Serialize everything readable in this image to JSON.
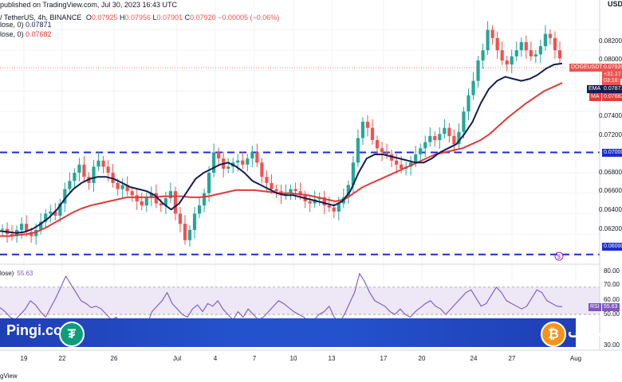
{
  "header": {
    "published": "published on TradingView.com, Jul 30, 2023 16:43 UTC",
    "symbol_line": "/ TetherUS, 4h, BINANCE",
    "ohlc": {
      "o_label": "O",
      "o": "0.07925",
      "h_label": "H",
      "h": "0.07956",
      "l_label": "L",
      "l": "0.07901",
      "c_label": "C",
      "c": "0.07920",
      "change": "−0.00005 (−0.06%)"
    },
    "ema_line_label": "lose, 0)",
    "ema_line_value": "0.07871",
    "ma_line_label": "lose, 0)",
    "ma_line_value": "0.07682",
    "corner_label": "USDT"
  },
  "colors": {
    "up": "#26a69a",
    "down": "#ef5350",
    "ema": "#131e4f",
    "ma": "#e23a3a",
    "level": "#1b2bd6",
    "rsi": "#7e57c2",
    "rsi_band": "#ede7f6",
    "brand": "#2451cc"
  },
  "icons": {
    "tether": "tether-icon",
    "bitcoin": "bitcoin-icon",
    "chart-event": "dollar-event-icon"
  },
  "badges": {
    "symbol": "DOGEUSDT",
    "last_price": "0.07920",
    "change_line": "+31.17",
    "countdown": "03:16:",
    "ema_name": "EMA",
    "ema_value": "0.07871",
    "ma_name": "MA",
    "ma_value": "0.07682",
    "rsi_name": "RSI",
    "rsi_value": "55.63",
    "level_high": "0.07000",
    "level_low": "0.06000"
  },
  "price_axis": {
    "ticks": [
      "0.08200",
      "0.08000",
      "0.07400",
      "0.07200",
      "0.06800",
      "0.06600",
      "0.06400",
      "0.06200"
    ]
  },
  "rsi_axis": {
    "ticks": [
      "80.00",
      "70.00",
      "60.00",
      "50.00",
      "30.00"
    ]
  },
  "rsi_panel": {
    "title": "lose)",
    "value": "55.63"
  },
  "time_axis": {
    "labels": [
      "19",
      "22",
      "26",
      "Jul",
      "4",
      "7",
      "10",
      "13",
      "17",
      "20",
      "24",
      "27",
      "Aug"
    ]
  },
  "brand": {
    "left": "Pingi.co",
    "right": "پینگی"
  },
  "footer": "gView",
  "chart_data": {
    "type": "candlestick",
    "title": "DOGE / TetherUS, 4h, BINANCE",
    "timeframe": "4h",
    "xlabels": [
      "19",
      "22",
      "26",
      "Jul",
      "4",
      "7",
      "10",
      "13",
      "17",
      "20",
      "24",
      "27",
      "Aug"
    ],
    "price_range": [
      0.0592,
      0.0843
    ],
    "horizontal_levels": [
      0.07,
      0.06
    ],
    "close_series": [
      0.0625,
      0.062,
      0.0618,
      0.0624,
      0.063,
      0.0622,
      0.0618,
      0.0624,
      0.0632,
      0.064,
      0.0642,
      0.0638,
      0.065,
      0.0664,
      0.0672,
      0.068,
      0.0688,
      0.0676,
      0.067,
      0.0686,
      0.0692,
      0.0686,
      0.068,
      0.067,
      0.0664,
      0.0668,
      0.0662,
      0.0658,
      0.0652,
      0.0648,
      0.0656,
      0.066,
      0.065,
      0.0648,
      0.0655,
      0.0662,
      0.064,
      0.063,
      0.0614,
      0.0624,
      0.064,
      0.0648,
      0.066,
      0.068,
      0.07,
      0.0694,
      0.0684,
      0.0686,
      0.069,
      0.0692,
      0.0688,
      0.0694,
      0.07,
      0.069,
      0.0676,
      0.067,
      0.0664,
      0.0662,
      0.0658,
      0.066,
      0.0664,
      0.0662,
      0.0658,
      0.0652,
      0.065,
      0.0654,
      0.0656,
      0.0648,
      0.0646,
      0.0642,
      0.065,
      0.0656,
      0.0668,
      0.069,
      0.0714,
      0.073,
      0.0724,
      0.0712,
      0.0704,
      0.07,
      0.0698,
      0.0692,
      0.0688,
      0.0684,
      0.0686,
      0.069,
      0.0698,
      0.0704,
      0.071,
      0.0716,
      0.0712,
      0.0718,
      0.0724,
      0.0716,
      0.0708,
      0.072,
      0.074,
      0.0756,
      0.077,
      0.079,
      0.08,
      0.082,
      0.0812,
      0.08,
      0.079,
      0.0786,
      0.0794,
      0.08,
      0.0808,
      0.08,
      0.0794,
      0.0796,
      0.0804,
      0.0816,
      0.0812,
      0.08,
      0.0792
    ],
    "ema_series": [
      0.0623,
      0.0622,
      0.0621,
      0.0622,
      0.0625,
      0.063,
      0.0636,
      0.0644,
      0.0655,
      0.0664,
      0.067,
      0.0674,
      0.0676,
      0.0676,
      0.0674,
      0.067,
      0.0666,
      0.0664,
      0.0662,
      0.0658,
      0.065,
      0.0644,
      0.065,
      0.0662,
      0.0674,
      0.068,
      0.0684,
      0.0688,
      0.069,
      0.0686,
      0.068,
      0.0672,
      0.0668,
      0.0664,
      0.066,
      0.0658,
      0.0658,
      0.0656,
      0.0654,
      0.0652,
      0.065,
      0.0648,
      0.0652,
      0.0662,
      0.068,
      0.0694,
      0.0698,
      0.0698,
      0.0696,
      0.0694,
      0.0692,
      0.069,
      0.069,
      0.0694,
      0.07,
      0.0704,
      0.0708,
      0.0718,
      0.073,
      0.0748,
      0.0762,
      0.077,
      0.0774,
      0.0772,
      0.077,
      0.0772,
      0.0776,
      0.0782,
      0.0786,
      0.0787
    ],
    "ma_series": [
      0.0618,
      0.0618,
      0.0619,
      0.062,
      0.0622,
      0.0626,
      0.0631,
      0.0636,
      0.0641,
      0.0645,
      0.0648,
      0.065,
      0.0652,
      0.0654,
      0.0656,
      0.0656,
      0.0656,
      0.0656,
      0.0657,
      0.0657,
      0.0657,
      0.0656,
      0.0656,
      0.0657,
      0.0659,
      0.0661,
      0.0663,
      0.0663,
      0.0663,
      0.0662,
      0.0661,
      0.066,
      0.066,
      0.0659,
      0.0658,
      0.0656,
      0.0654,
      0.0652,
      0.0654,
      0.066,
      0.0666,
      0.067,
      0.0674,
      0.0678,
      0.0682,
      0.0686,
      0.069,
      0.0694,
      0.0698,
      0.07,
      0.0702,
      0.0704,
      0.0708,
      0.0712,
      0.0718,
      0.0726,
      0.0734,
      0.0741,
      0.0748,
      0.0754,
      0.076,
      0.0764,
      0.0768
    ],
    "rsi_range": [
      25,
      85
    ],
    "rsi_series": [
      55,
      52,
      48,
      46,
      50,
      54,
      60,
      57,
      52,
      48,
      55,
      62,
      70,
      78,
      72,
      66,
      60,
      58,
      55,
      56,
      54,
      50,
      46,
      48,
      42,
      45,
      40,
      36,
      30,
      42,
      52,
      56,
      60,
      66,
      58,
      54,
      50,
      48,
      54,
      57,
      52,
      58,
      56,
      60,
      54,
      50,
      46,
      52,
      48,
      54,
      50,
      46,
      48,
      52,
      56,
      60,
      58,
      55,
      52,
      50,
      48,
      44,
      46,
      50,
      52,
      56,
      48,
      44,
      50,
      58,
      66,
      80,
      74,
      66,
      60,
      58,
      56,
      52,
      50,
      54,
      50,
      48,
      52,
      55,
      58,
      60,
      56,
      54,
      50,
      54,
      58,
      62,
      66,
      68,
      62,
      56,
      58,
      64,
      70,
      66,
      60,
      58,
      56,
      54,
      56,
      62,
      68,
      66,
      60,
      58,
      56,
      55.63
    ],
    "last_rsi": 55.63
  }
}
